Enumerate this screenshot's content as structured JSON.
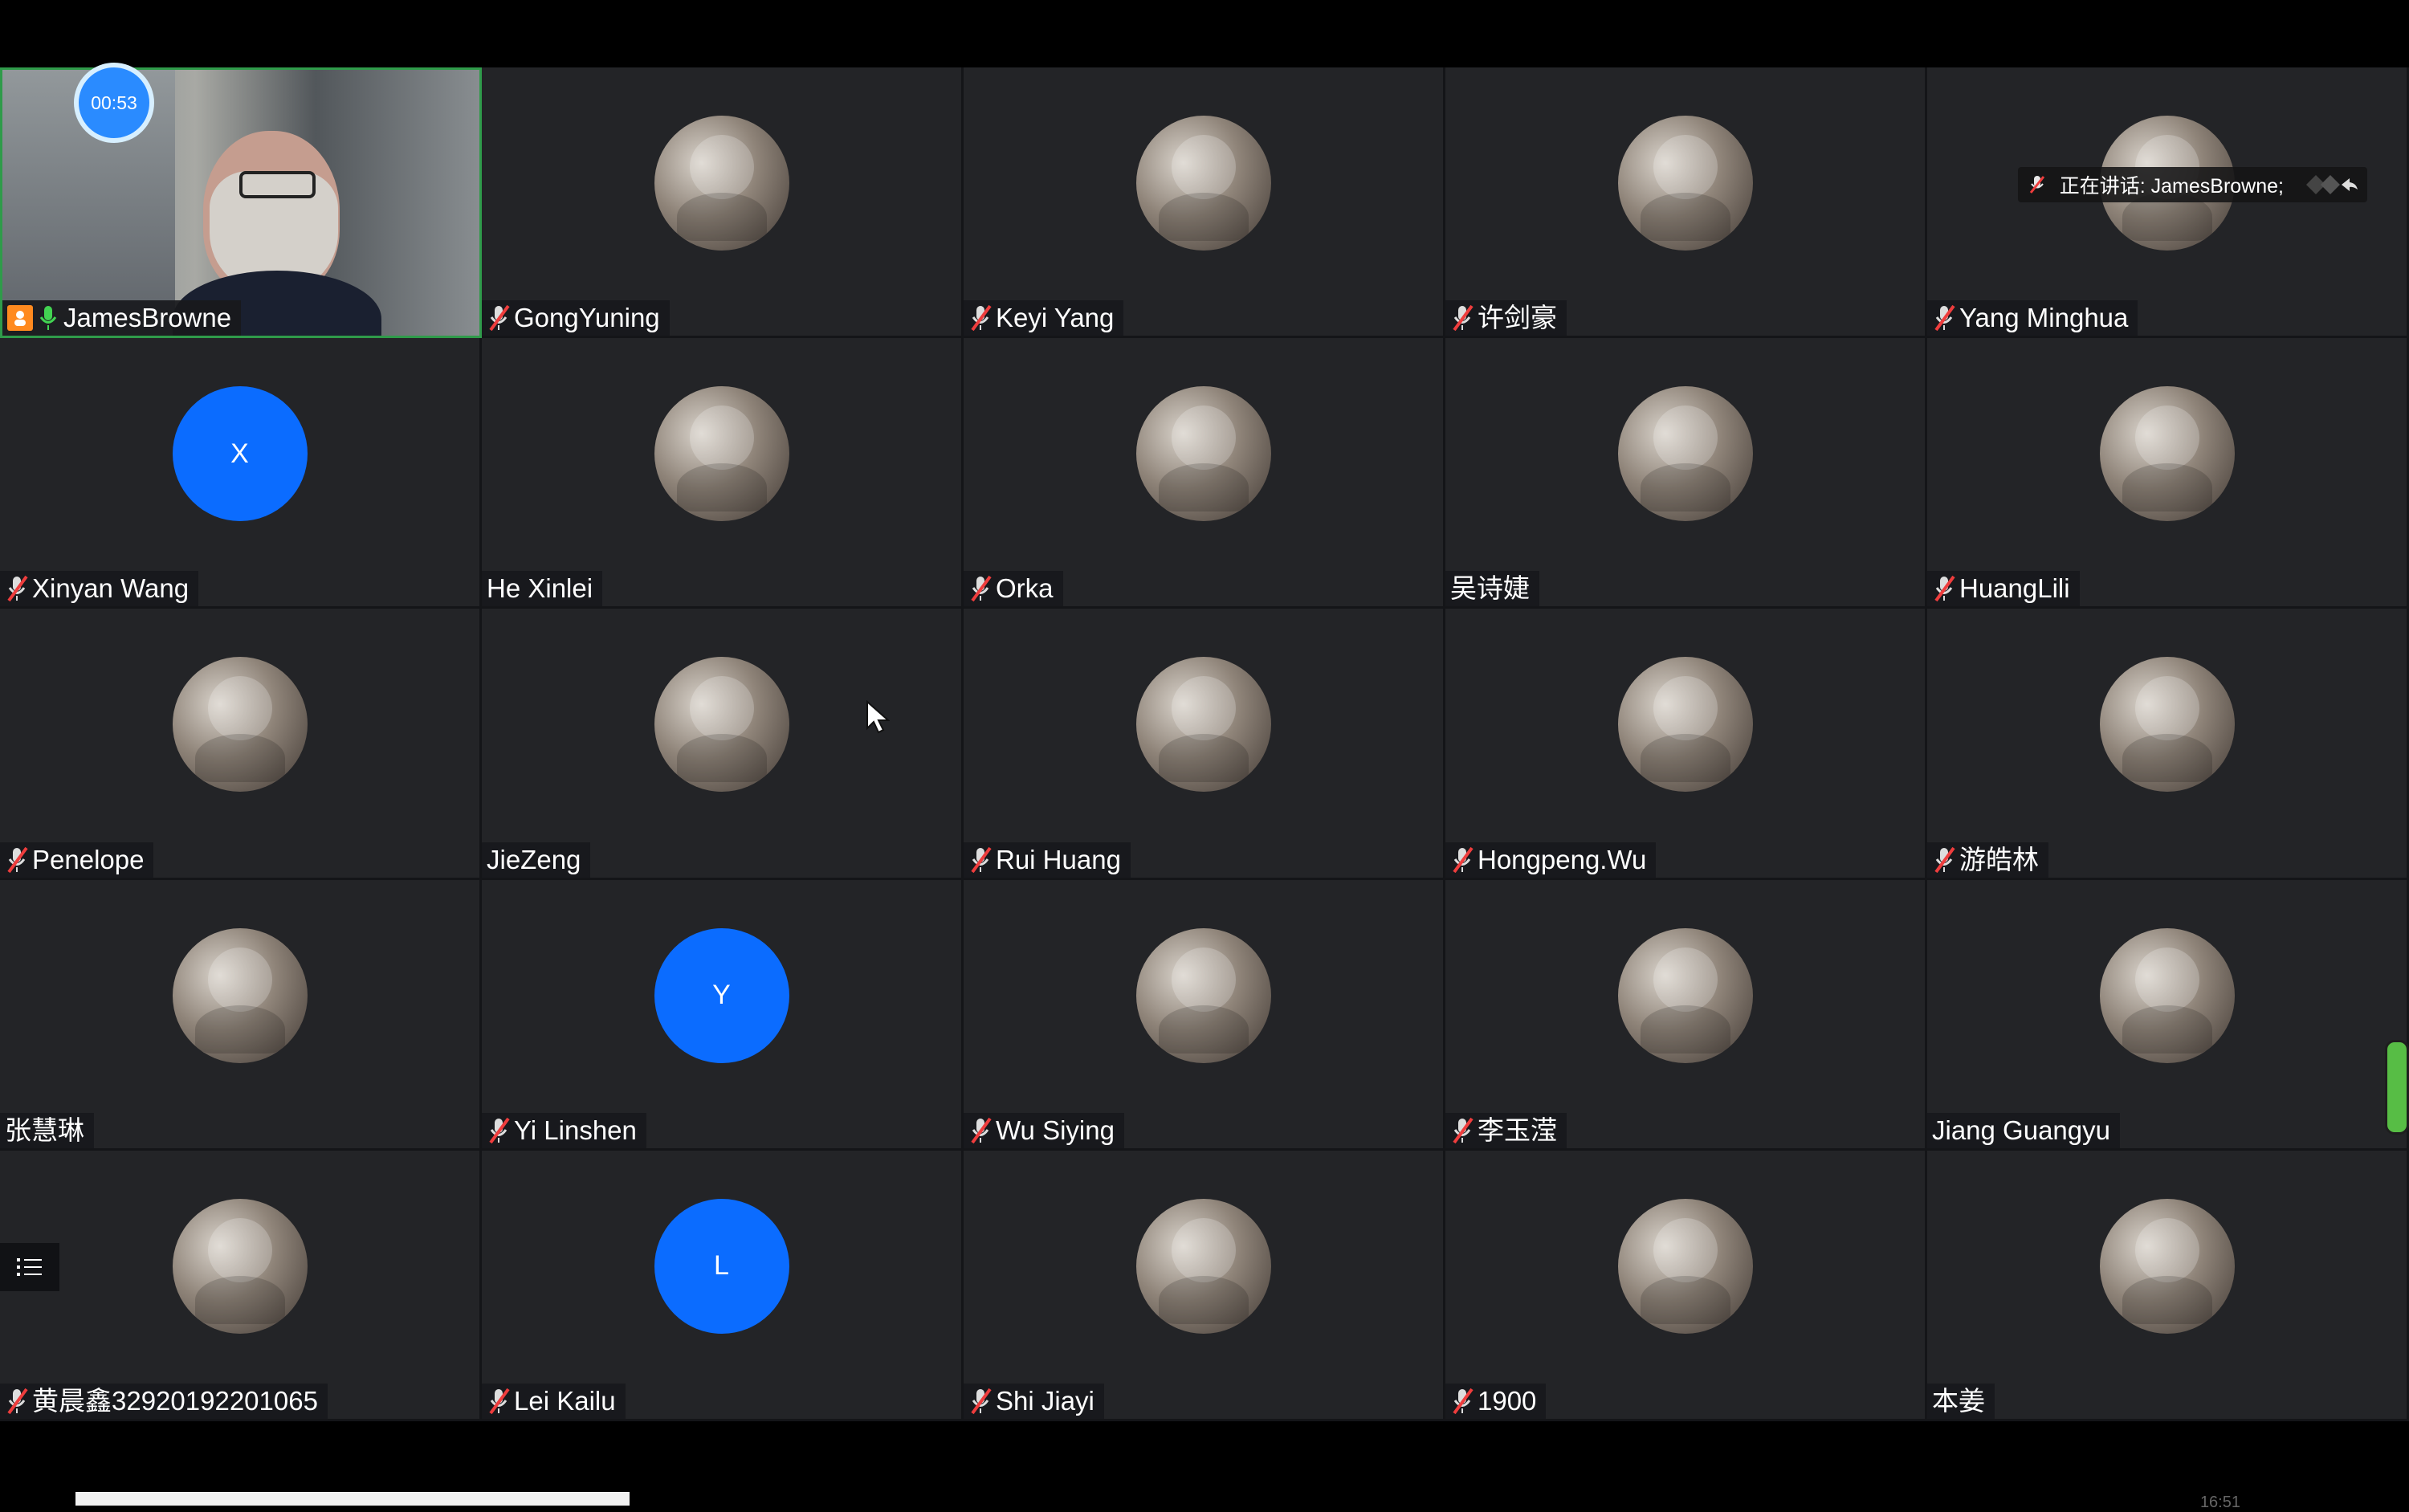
{
  "meeting": {
    "timer": "00:53",
    "speaking_label": "正在讲话: JamesBrowne;",
    "bottom_time": "16:51"
  },
  "participants": [
    {
      "name": "JamesBrowne",
      "muted": false,
      "host": true,
      "avatar": "video"
    },
    {
      "name": "GongYuning",
      "muted": true,
      "avatar": "cat-photo"
    },
    {
      "name": "Keyi Yang",
      "muted": true,
      "avatar": "nature-photo"
    },
    {
      "name": "许剑豪",
      "muted": true,
      "avatar": "cartoon-dog"
    },
    {
      "name": "Yang Minghua",
      "muted": true,
      "avatar": "person-photo"
    },
    {
      "name": "Xinyan Wang",
      "muted": true,
      "avatar": "letter",
      "letter": "X"
    },
    {
      "name": "He Xinlei",
      "muted": false,
      "avatar": "cartoon-bear"
    },
    {
      "name": "Orka",
      "muted": true,
      "avatar": "person-photo"
    },
    {
      "name": "吴诗婕",
      "muted": false,
      "avatar": "dog-photo"
    },
    {
      "name": "HuangLili",
      "muted": true,
      "avatar": "heart"
    },
    {
      "name": "Penelope",
      "muted": true,
      "avatar": "girl-drawing"
    },
    {
      "name": "JieZeng",
      "muted": false,
      "avatar": "sea-photo"
    },
    {
      "name": "Rui Huang",
      "muted": true,
      "avatar": "anime-girl"
    },
    {
      "name": "Hongpeng.Wu",
      "muted": true,
      "avatar": "blue-bird"
    },
    {
      "name": "游皓林",
      "muted": true,
      "avatar": "stadium-photo"
    },
    {
      "name": "张慧琳",
      "muted": false,
      "avatar": "puppy-photo"
    },
    {
      "name": "Yi Linshen",
      "muted": true,
      "avatar": "letter",
      "letter": "Y"
    },
    {
      "name": "Wu Siying",
      "muted": true,
      "avatar": "cartoon-face"
    },
    {
      "name": "李玉滢",
      "muted": true,
      "avatar": "ink-drawing"
    },
    {
      "name": "Jiang Guangyu",
      "muted": false,
      "avatar": "portrait-photo"
    },
    {
      "name": "黄晨鑫32920192201065",
      "muted": true,
      "avatar": "tintin"
    },
    {
      "name": "Lei Kailu",
      "muted": true,
      "avatar": "letter",
      "letter": "L"
    },
    {
      "name": "Shi Jiayi",
      "muted": true,
      "avatar": "cartoon-cat"
    },
    {
      "name": "1900",
      "muted": true,
      "avatar": "fox-cartoon"
    },
    {
      "name": "本姜",
      "muted": false,
      "avatar": "bad-badtz-maru"
    }
  ],
  "colors": {
    "letter_avatar": "#0b6cff",
    "muted_red": "#ef3d3d",
    "video_border": "#2f9b4a",
    "timer": "#2a8bff"
  }
}
